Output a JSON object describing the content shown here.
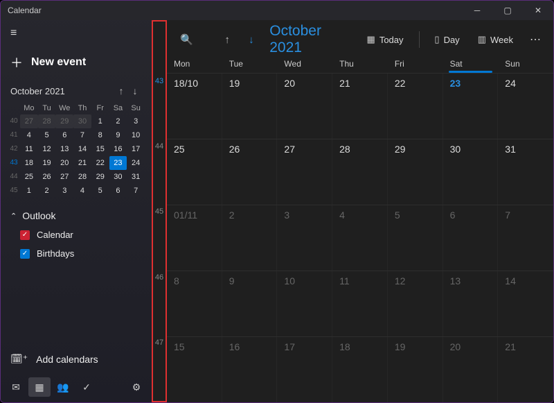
{
  "title": "Calendar",
  "sidebar": {
    "newEvent": "New event",
    "miniMonth": "October 2021",
    "dowShort": [
      "Mo",
      "Tu",
      "We",
      "Th",
      "Fr",
      "Sa",
      "Su"
    ],
    "miniWeeks": [
      {
        "wk": "40",
        "days": [
          {
            "n": "27",
            "o": true
          },
          {
            "n": "28",
            "o": true
          },
          {
            "n": "29",
            "o": true
          },
          {
            "n": "30",
            "o": true
          },
          {
            "n": "1"
          },
          {
            "n": "2"
          },
          {
            "n": "3"
          }
        ]
      },
      {
        "wk": "41",
        "days": [
          {
            "n": "4"
          },
          {
            "n": "5"
          },
          {
            "n": "6"
          },
          {
            "n": "7"
          },
          {
            "n": "8"
          },
          {
            "n": "9"
          },
          {
            "n": "10"
          }
        ]
      },
      {
        "wk": "42",
        "days": [
          {
            "n": "11"
          },
          {
            "n": "12"
          },
          {
            "n": "13"
          },
          {
            "n": "14"
          },
          {
            "n": "15"
          },
          {
            "n": "16"
          },
          {
            "n": "17"
          }
        ]
      },
      {
        "wk": "43",
        "cur": true,
        "days": [
          {
            "n": "18"
          },
          {
            "n": "19"
          },
          {
            "n": "20"
          },
          {
            "n": "21"
          },
          {
            "n": "22"
          },
          {
            "n": "23",
            "today": true
          },
          {
            "n": "24"
          }
        ]
      },
      {
        "wk": "44",
        "days": [
          {
            "n": "25"
          },
          {
            "n": "26"
          },
          {
            "n": "27"
          },
          {
            "n": "28"
          },
          {
            "n": "29"
          },
          {
            "n": "30"
          },
          {
            "n": "31"
          }
        ]
      },
      {
        "wk": "45",
        "days": [
          {
            "n": "1"
          },
          {
            "n": "2"
          },
          {
            "n": "3"
          },
          {
            "n": "4"
          },
          {
            "n": "5"
          },
          {
            "n": "6"
          },
          {
            "n": "7"
          }
        ]
      }
    ],
    "outlook": "Outlook",
    "calendars": [
      {
        "label": "Calendar",
        "color": "red"
      },
      {
        "label": "Birthdays",
        "color": "blue"
      }
    ],
    "addCalendars": "Add calendars"
  },
  "toolbar": {
    "monthTitle": "October 2021",
    "today": "Today",
    "day": "Day",
    "week": "Week"
  },
  "dow": [
    "Mon",
    "Tue",
    "Wed",
    "Thu",
    "Fri",
    "Sat",
    "Sun"
  ],
  "todayDowIndex": 5,
  "weekNumbers": [
    "43",
    "44",
    "45",
    "46",
    "47"
  ],
  "currentWeekIndex": 0,
  "monthRows": [
    [
      {
        "n": "18/10"
      },
      {
        "n": "19"
      },
      {
        "n": "20"
      },
      {
        "n": "21"
      },
      {
        "n": "22"
      },
      {
        "n": "23",
        "today": true
      },
      {
        "n": "24"
      }
    ],
    [
      {
        "n": "25"
      },
      {
        "n": "26"
      },
      {
        "n": "27"
      },
      {
        "n": "28"
      },
      {
        "n": "29"
      },
      {
        "n": "30"
      },
      {
        "n": "31"
      }
    ],
    [
      {
        "n": "01/11",
        "o": true
      },
      {
        "n": "2",
        "o": true
      },
      {
        "n": "3",
        "o": true
      },
      {
        "n": "4",
        "o": true
      },
      {
        "n": "5",
        "o": true
      },
      {
        "n": "6",
        "o": true
      },
      {
        "n": "7",
        "o": true
      }
    ],
    [
      {
        "n": "8",
        "o": true
      },
      {
        "n": "9",
        "o": true
      },
      {
        "n": "10",
        "o": true
      },
      {
        "n": "11",
        "o": true
      },
      {
        "n": "12",
        "o": true
      },
      {
        "n": "13",
        "o": true
      },
      {
        "n": "14",
        "o": true
      }
    ],
    [
      {
        "n": "15",
        "o": true
      },
      {
        "n": "16",
        "o": true
      },
      {
        "n": "17",
        "o": true
      },
      {
        "n": "18",
        "o": true
      },
      {
        "n": "19",
        "o": true
      },
      {
        "n": "20",
        "o": true
      },
      {
        "n": "21",
        "o": true
      }
    ]
  ]
}
